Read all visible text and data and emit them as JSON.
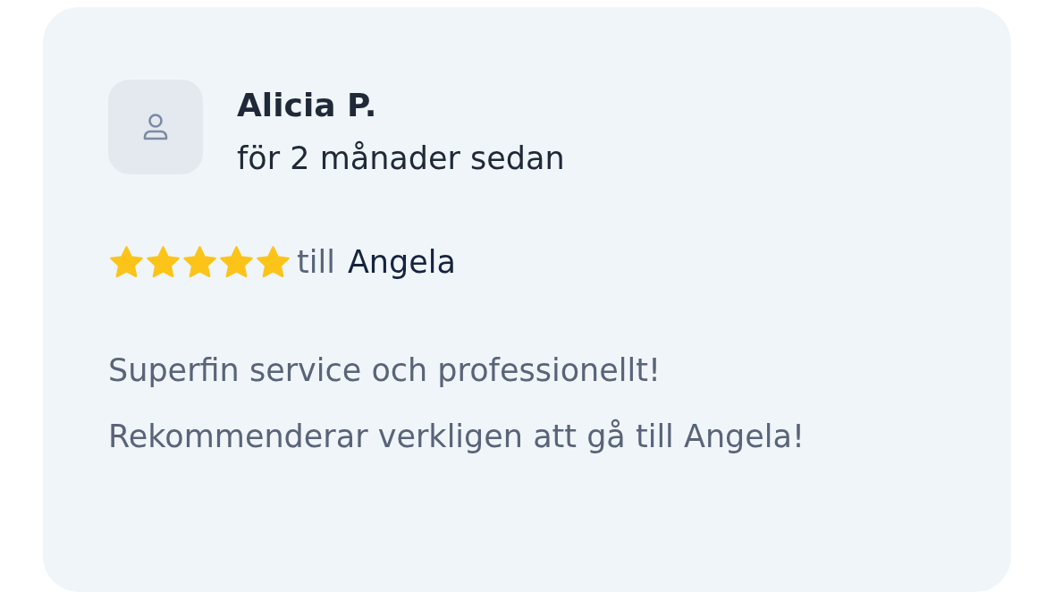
{
  "review": {
    "author": "Alicia P.",
    "time": "för 2 månader sedan",
    "stars": 5,
    "recipient_prefix": "till",
    "recipient": "Angela",
    "text": "Superfin service och professionellt! Rekommenderar verkligen att gå till Angela!"
  }
}
